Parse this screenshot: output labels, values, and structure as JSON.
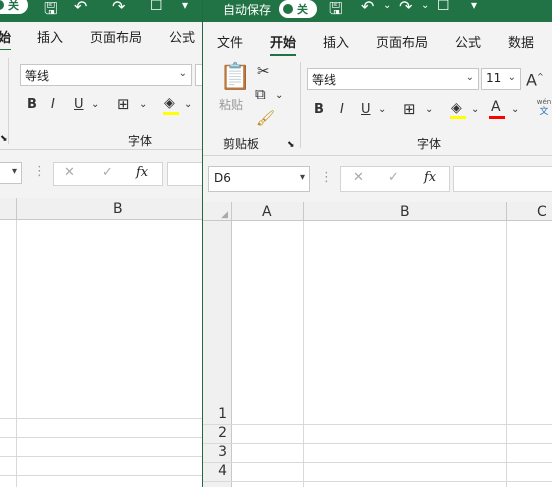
{
  "window_back": {
    "active_tab_partial": "始",
    "tabs": [
      "插入",
      "页面布局",
      "公式"
    ],
    "font_name": "等线",
    "font_group_label": "字体",
    "fx_label": "fx",
    "column_b": "B"
  },
  "window_front": {
    "autosave_label": "自动保存",
    "toggle_label": "关",
    "tabs": [
      "文件",
      "开始",
      "插入",
      "页面布局",
      "公式",
      "数据"
    ],
    "paste_label": "粘贴",
    "clipboard_group_label": "剪贴板",
    "font_name": "等线",
    "font_size": "11",
    "font_group_label": "字体",
    "name_box": "D6",
    "fx_label": "fx",
    "wen_label_top": "wén",
    "wen_label_bottom": "文",
    "columns": [
      "A",
      "B",
      "C"
    ],
    "rows": [
      "1",
      "2",
      "3",
      "4"
    ]
  },
  "colors": {
    "excel_green": "#217346",
    "highlight_yellow": "#ffff00",
    "font_red": "#ff0000"
  }
}
